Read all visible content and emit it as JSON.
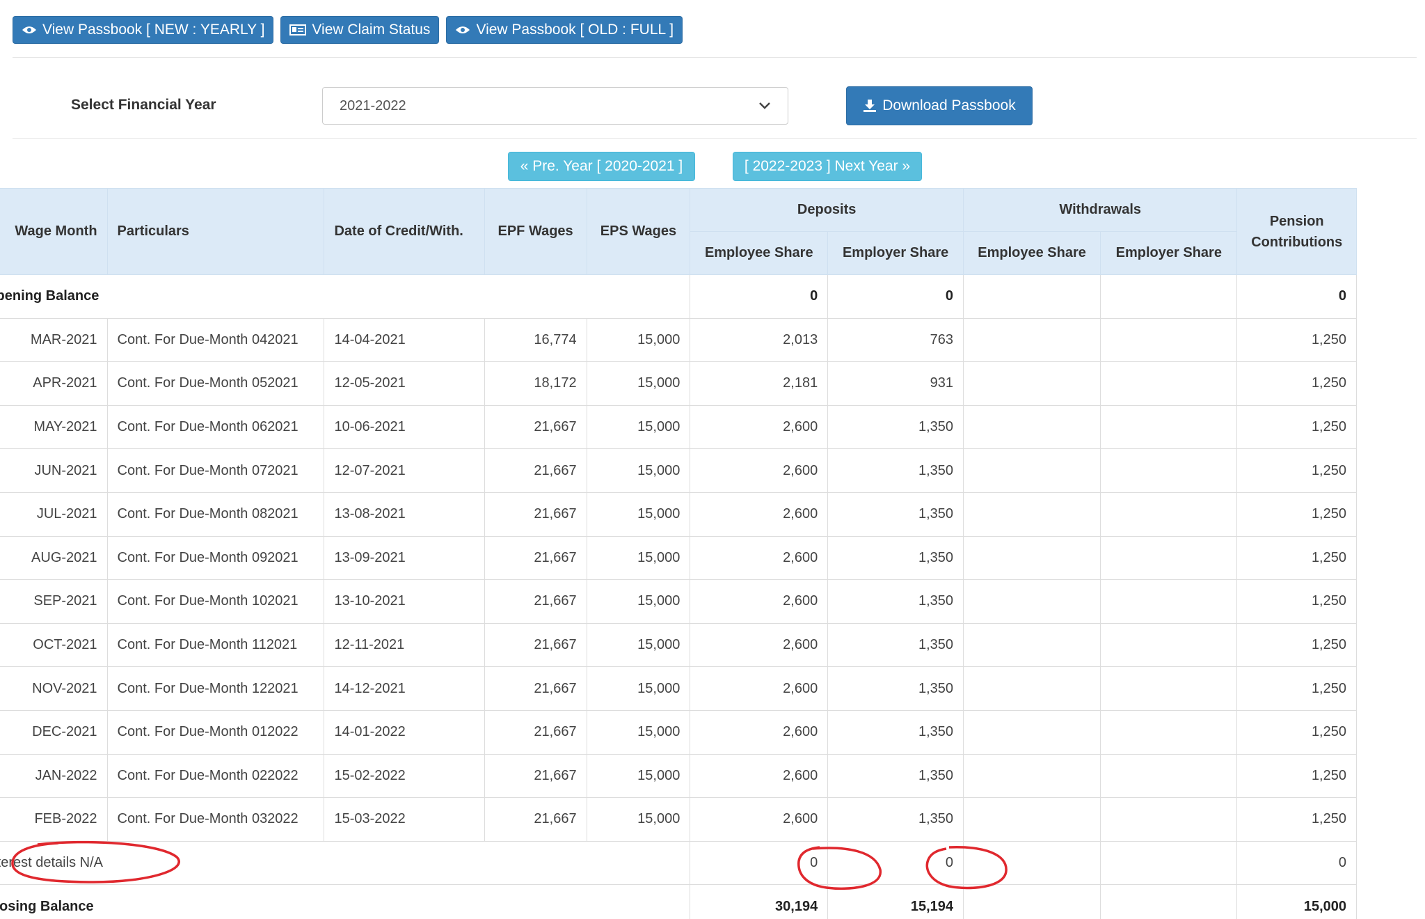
{
  "top_buttons": [
    {
      "label": "View Passbook [ NEW : YEARLY ]",
      "icon": "eye-icon"
    },
    {
      "label": "View Claim Status",
      "icon": "id-card-icon"
    },
    {
      "label": "View Passbook [ OLD : FULL ]",
      "icon": "eye-icon"
    }
  ],
  "financial_year": {
    "label": "Select Financial Year",
    "selected": "2021-2022",
    "download_label": "Download Passbook"
  },
  "year_nav": {
    "prev_label": "« Pre. Year [ 2020-2021 ]",
    "next_label": "[ 2022-2023 ] Next Year »"
  },
  "table": {
    "headers": {
      "wage_month": "Wage Month",
      "particulars": "Particulars",
      "date": "Date of Credit/With.",
      "epf_wages": "EPF Wages",
      "eps_wages": "EPS Wages",
      "deposits": "Deposits",
      "withdrawals": "Withdrawals",
      "employee_share": "Employee Share",
      "employer_share": "Employer Share",
      "pension": "Pension Contributions"
    },
    "opening": {
      "label": "Opening Balance",
      "dep_emp": "0",
      "dep_empr": "0",
      "pension": "0"
    },
    "rows": [
      {
        "month": "MAR-2021",
        "particulars": "Cont. For Due-Month 042021",
        "date": "14-04-2021",
        "epf": "16,774",
        "eps": "15,000",
        "dep_emp": "2,013",
        "dep_empr": "763",
        "wd_emp": "",
        "wd_empr": "",
        "pension": "1,250"
      },
      {
        "month": "APR-2021",
        "particulars": "Cont. For Due-Month 052021",
        "date": "12-05-2021",
        "epf": "18,172",
        "eps": "15,000",
        "dep_emp": "2,181",
        "dep_empr": "931",
        "wd_emp": "",
        "wd_empr": "",
        "pension": "1,250"
      },
      {
        "month": "MAY-2021",
        "particulars": "Cont. For Due-Month 062021",
        "date": "10-06-2021",
        "epf": "21,667",
        "eps": "15,000",
        "dep_emp": "2,600",
        "dep_empr": "1,350",
        "wd_emp": "",
        "wd_empr": "",
        "pension": "1,250"
      },
      {
        "month": "JUN-2021",
        "particulars": "Cont. For Due-Month 072021",
        "date": "12-07-2021",
        "epf": "21,667",
        "eps": "15,000",
        "dep_emp": "2,600",
        "dep_empr": "1,350",
        "wd_emp": "",
        "wd_empr": "",
        "pension": "1,250"
      },
      {
        "month": "JUL-2021",
        "particulars": "Cont. For Due-Month 082021",
        "date": "13-08-2021",
        "epf": "21,667",
        "eps": "15,000",
        "dep_emp": "2,600",
        "dep_empr": "1,350",
        "wd_emp": "",
        "wd_empr": "",
        "pension": "1,250"
      },
      {
        "month": "AUG-2021",
        "particulars": "Cont. For Due-Month 092021",
        "date": "13-09-2021",
        "epf": "21,667",
        "eps": "15,000",
        "dep_emp": "2,600",
        "dep_empr": "1,350",
        "wd_emp": "",
        "wd_empr": "",
        "pension": "1,250"
      },
      {
        "month": "SEP-2021",
        "particulars": "Cont. For Due-Month 102021",
        "date": "13-10-2021",
        "epf": "21,667",
        "eps": "15,000",
        "dep_emp": "2,600",
        "dep_empr": "1,350",
        "wd_emp": "",
        "wd_empr": "",
        "pension": "1,250"
      },
      {
        "month": "OCT-2021",
        "particulars": "Cont. For Due-Month 112021",
        "date": "12-11-2021",
        "epf": "21,667",
        "eps": "15,000",
        "dep_emp": "2,600",
        "dep_empr": "1,350",
        "wd_emp": "",
        "wd_empr": "",
        "pension": "1,250"
      },
      {
        "month": "NOV-2021",
        "particulars": "Cont. For Due-Month 122021",
        "date": "14-12-2021",
        "epf": "21,667",
        "eps": "15,000",
        "dep_emp": "2,600",
        "dep_empr": "1,350",
        "wd_emp": "",
        "wd_empr": "",
        "pension": "1,250"
      },
      {
        "month": "DEC-2021",
        "particulars": "Cont. For Due-Month 012022",
        "date": "14-01-2022",
        "epf": "21,667",
        "eps": "15,000",
        "dep_emp": "2,600",
        "dep_empr": "1,350",
        "wd_emp": "",
        "wd_empr": "",
        "pension": "1,250"
      },
      {
        "month": "JAN-2022",
        "particulars": "Cont. For Due-Month 022022",
        "date": "15-02-2022",
        "epf": "21,667",
        "eps": "15,000",
        "dep_emp": "2,600",
        "dep_empr": "1,350",
        "wd_emp": "",
        "wd_empr": "",
        "pension": "1,250"
      },
      {
        "month": "FEB-2022",
        "particulars": "Cont. For Due-Month 032022",
        "date": "15-03-2022",
        "epf": "21,667",
        "eps": "15,000",
        "dep_emp": "2,600",
        "dep_empr": "1,350",
        "wd_emp": "",
        "wd_empr": "",
        "pension": "1,250"
      }
    ],
    "interest": {
      "label": "Interest details N/A",
      "dep_emp": "0",
      "dep_empr": "0",
      "pension": "0"
    },
    "closing": {
      "label": "Closing Balance",
      "dep_emp": "30,194",
      "dep_empr": "15,194",
      "pension": "15,000"
    }
  },
  "annotation_color": "#e0282e",
  "colors": {
    "primary": "#337ab7",
    "info": "#5bc0de",
    "header_bg": "#dceaf7"
  }
}
